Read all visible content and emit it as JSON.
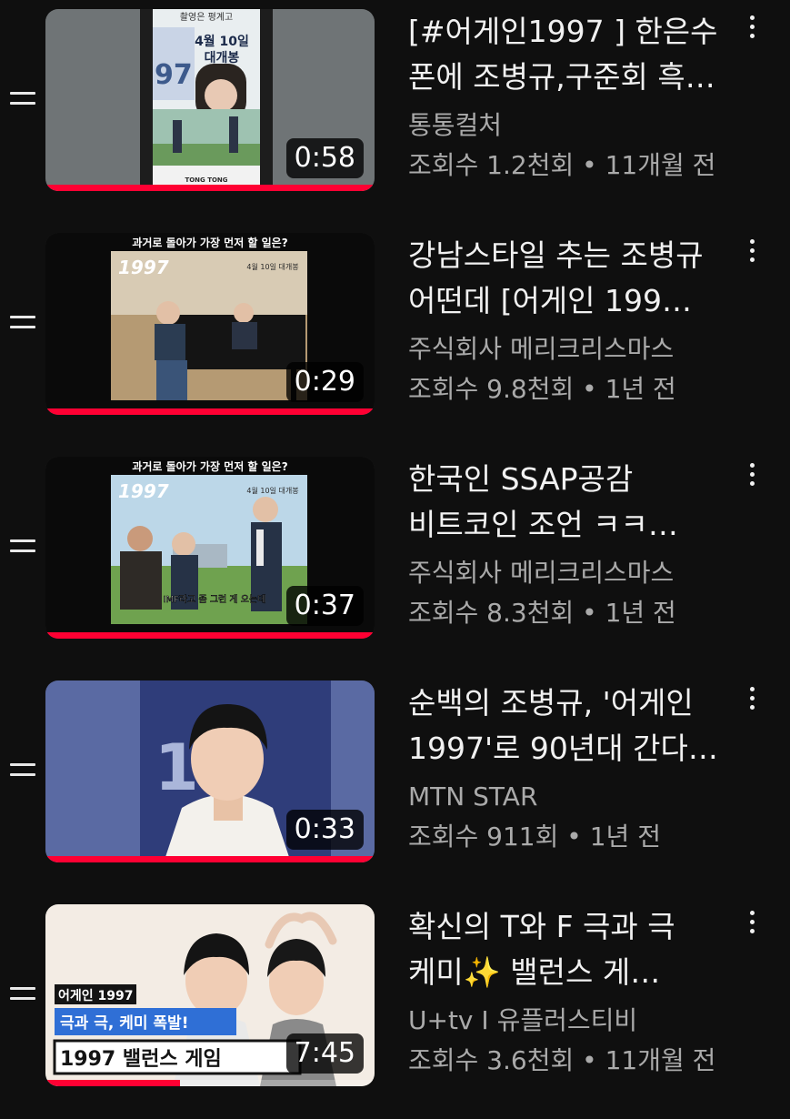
{
  "videos": [
    {
      "title": "[#어게인1997 ] 한은수 폰에 조병규,구준회 흑…",
      "channel": "통통컬처",
      "views": "조회수 1.2천회",
      "age": "11개월 전",
      "duration": "0:58",
      "progress": 1.0,
      "thumb_text": [
        "촬영은 평계고",
        "4월 10일",
        "대개봉",
        "TONG TONG"
      ]
    },
    {
      "title": "강남스타일 추는 조병규 어떤데 [어게인 199…",
      "channel": "주식회사 메리크리스마스",
      "views": "조회수 9.8천회",
      "age": "1년 전",
      "duration": "0:29",
      "progress": 1.0,
      "thumb_text": [
        "과거로 돌아가 가장 먼저 할 일은?",
        "1997",
        "4월 10일 대개봉"
      ]
    },
    {
      "title": "한국인 SSAP공감 비트코인 조언 ㅋㅋ [어…",
      "channel": "주식회사 메리크리스마스",
      "views": "조회수 8.3천회",
      "age": "1년 전",
      "duration": "0:37",
      "progress": 1.0,
      "thumb_text": [
        "과거로 돌아가 가장 먼저 할 일은?",
        "1997",
        "4월 10일 대개봉",
        "IMF라고 좀 그런 게 오는데"
      ]
    },
    {
      "title": "순백의 조병규, '어게인 1997'로 90년대 간다 …",
      "channel": "MTN STAR",
      "views": "조회수 911회",
      "age": "1년 전",
      "duration": "0:33",
      "progress": 1.0,
      "thumb_text": [
        "19"
      ]
    },
    {
      "title": "확신의 T와 F 극과 극 케미✨ 밸런스 게…",
      "channel": "U+tv I 유플러스티비",
      "views": "조회수 3.6천회",
      "age": "11개월 전",
      "duration": "7:45",
      "progress": 0.41,
      "thumb_text": [
        "어게인 1997",
        "극과 극, 케미 폭발!",
        "1997 밸런스 게임"
      ]
    }
  ],
  "separator": " • ",
  "colors": {
    "background": "#0f0f0f",
    "progress": "#ff0033",
    "secondary_text": "#aaaaaa"
  },
  "icons": {
    "drag": "drag-handle-icon",
    "menu": "more-vert-icon"
  }
}
